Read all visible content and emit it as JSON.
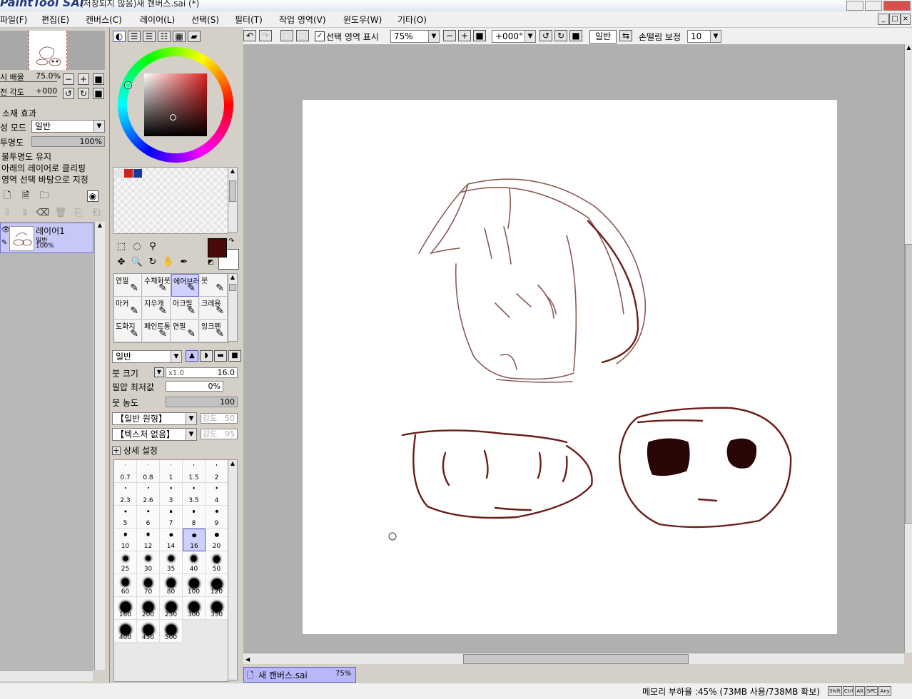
{
  "window": {
    "logo": "PaintTool SAI",
    "title": "(저장되지 않음)새 캔버스.sai (*)"
  },
  "menu": [
    {
      "label": "파일(F)"
    },
    {
      "label": "편집(E)"
    },
    {
      "label": "캔버스(C)"
    },
    {
      "label": "레이어(L)"
    },
    {
      "label": "선택(S)"
    },
    {
      "label": "필터(T)"
    },
    {
      "label": "작업 영역(V)"
    },
    {
      "label": "윈도우(W)"
    },
    {
      "label": "기타(O)"
    }
  ],
  "navigator": {
    "zoom_label": "시 배율",
    "zoom_value": "75.0%",
    "angle_label": "전 각도",
    "angle_value": "+000"
  },
  "layer_props": {
    "effect_label": "소재 효과",
    "blend_label": "성 모드",
    "blend_value": "일반",
    "opacity_label": "투명도",
    "opacity_value": "100%",
    "opacity_fraction": 1.0,
    "preserve_opacity": "불투명도 유지",
    "clip_lower": "아래의 레이어로 클리핑",
    "selection_source": "영역 선택 바탕으로 지정"
  },
  "layers": [
    {
      "name": "레이어1",
      "mode": "일반",
      "opacity": "100%"
    }
  ],
  "colors": {
    "primary": "#4a0a0a",
    "secondary": "#ffffff",
    "swatches": [
      "#e8e4e4",
      "#cc2222",
      "#1a3a9a"
    ]
  },
  "toolbar": {
    "show_selection_label": "선택 영역 표시",
    "zoom_value": "75%",
    "angle_value": "+000°",
    "mode_label": "일반",
    "stabilizer_label": "손떨림 보정",
    "stabilizer_value": "10"
  },
  "brushes": [
    {
      "name": "연필",
      "icon": "pencil-icon"
    },
    {
      "name": "수채화붓",
      "icon": "watercolor-icon"
    },
    {
      "name": "에어브러시",
      "icon": "airbrush-icon",
      "selected": true
    },
    {
      "name": "붓",
      "icon": "brush-icon"
    },
    {
      "name": "마커",
      "icon": "marker-icon"
    },
    {
      "name": "지우개",
      "icon": "eraser-icon"
    },
    {
      "name": "아크릴",
      "icon": "acrylic-icon"
    },
    {
      "name": "크레용",
      "icon": "crayon-icon"
    },
    {
      "name": "도화지",
      "icon": "paper-icon"
    },
    {
      "name": "페인트통",
      "icon": "bucket-icon"
    },
    {
      "name": "연필",
      "icon": "pencil-icon"
    },
    {
      "name": "잉크펜",
      "icon": "ink-pen-icon"
    }
  ],
  "brush_settings": {
    "mode_value": "일반",
    "size_label": "붓 크기",
    "size_multiplier": "x1.0",
    "size_value": "16.0",
    "min_pressure_label": "필압 최저값",
    "min_pressure_value": "0%",
    "density_label": "붓 농도",
    "density_value": "100",
    "shape_value": "【일반 원형】",
    "shape_strength_label": "강도",
    "shape_strength_value": "50",
    "texture_value": "【텍스처 없음】",
    "texture_strength_label": "강도",
    "texture_strength_value": "95",
    "advanced_label": "상세 설정"
  },
  "brush_sizes": [
    "0.7",
    "0.8",
    "1",
    "1.5",
    "2",
    "2.3",
    "2.6",
    "3",
    "3.5",
    "4",
    "5",
    "6",
    "7",
    "8",
    "9",
    "10",
    "12",
    "14",
    "16",
    "20",
    "25",
    "30",
    "35",
    "40",
    "50",
    "60",
    "70",
    "80",
    "100",
    "120",
    "160",
    "200",
    "250",
    "300",
    "350",
    "400",
    "450",
    "500"
  ],
  "selected_brush_size": "16",
  "document_tab": {
    "name": "새 캔버스.sai",
    "zoom": "75%"
  },
  "status": {
    "memory": "메모리 부하율 :45% (73MB 사용/738MB 확보)",
    "keys": [
      "Shift",
      "Ctrl",
      "Alt",
      "SPC",
      "Any"
    ]
  }
}
